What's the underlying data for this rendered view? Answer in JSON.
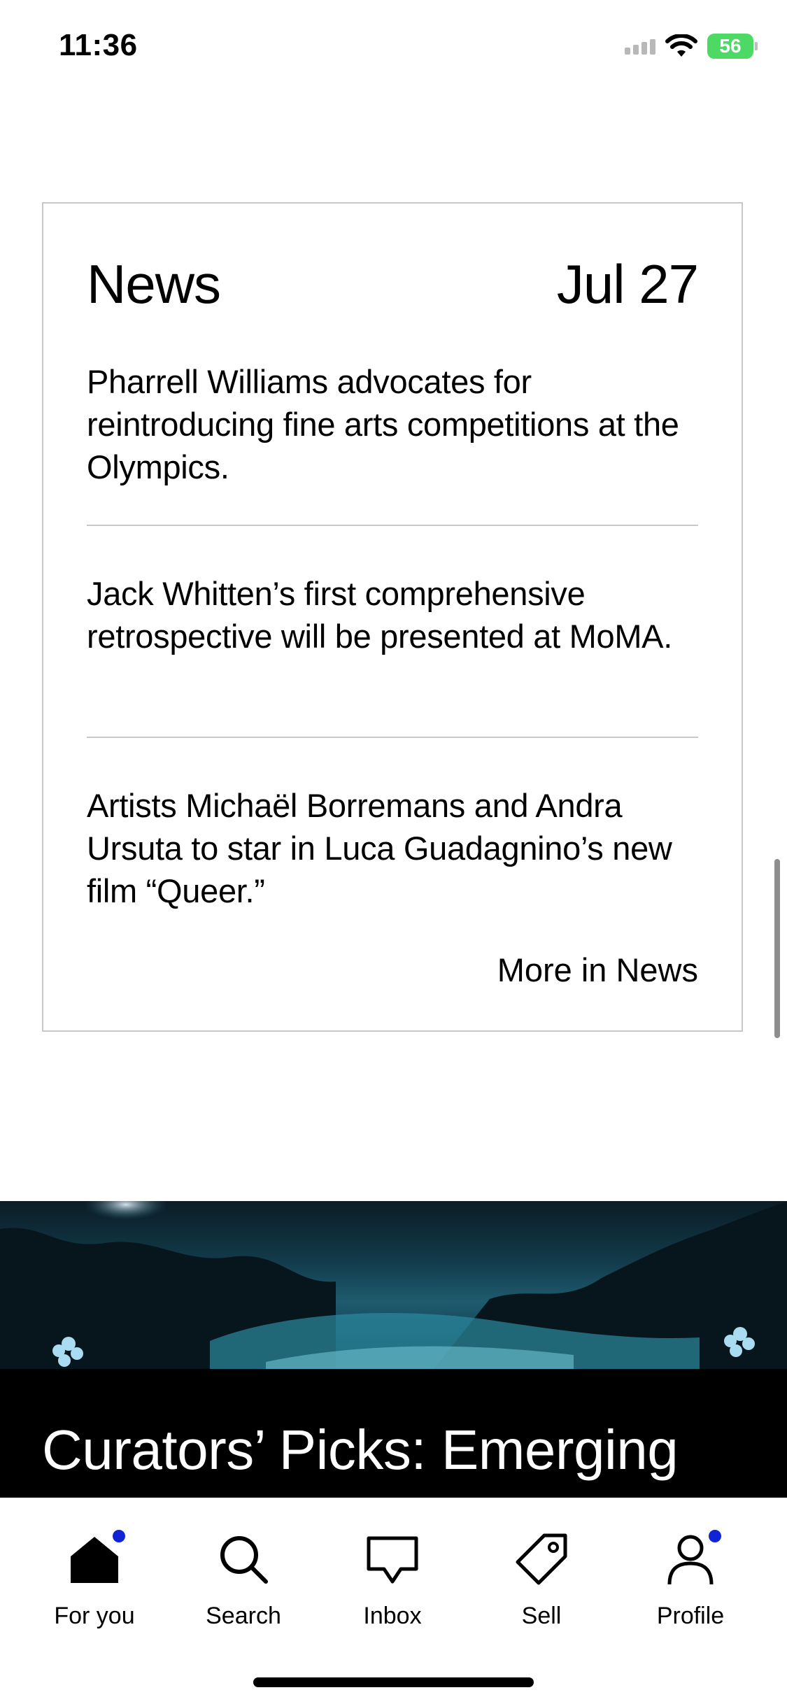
{
  "status_bar": {
    "time": "11:36",
    "battery": "56"
  },
  "news": {
    "title": "News",
    "date": "Jul 27",
    "items": [
      "Pharrell Williams advocates for reintroducing fine arts competitions at the Olympics.",
      "Jack Whitten’s first comprehensive retrospective will be presented at MoMA.",
      "Artists Michaël Borremans and Andra Ursuta to star in Luca Guadagnino’s new film “Queer.”"
    ],
    "more_label": "More in News"
  },
  "feature": {
    "title": "Curators’ Picks: Emerging"
  },
  "tabbar": {
    "items": [
      {
        "label": "For you",
        "icon": "home-icon",
        "badge": true
      },
      {
        "label": "Search",
        "icon": "search-icon",
        "badge": false
      },
      {
        "label": "Inbox",
        "icon": "inbox-icon",
        "badge": false
      },
      {
        "label": "Sell",
        "icon": "tag-icon",
        "badge": false
      },
      {
        "label": "Profile",
        "icon": "profile-icon",
        "badge": true
      }
    ]
  },
  "colors": {
    "badge": "#1023d7",
    "battery": "#4cd964",
    "divider": "#c8c8c8"
  }
}
